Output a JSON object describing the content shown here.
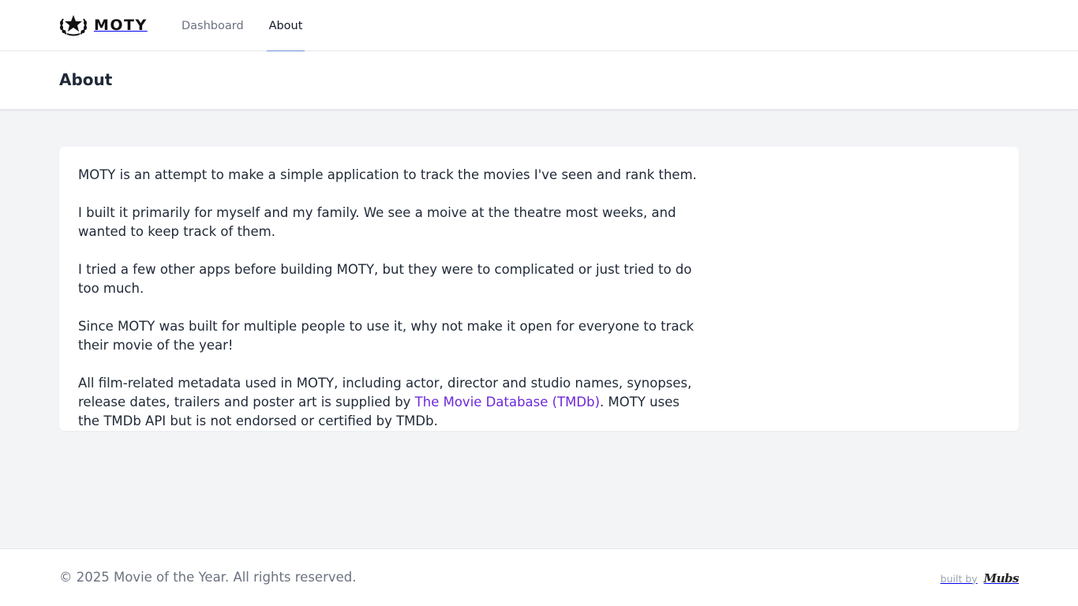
{
  "nav": {
    "logo_text": "MOTY",
    "logo_icon": "laurel-star-icon",
    "links": [
      {
        "label": "Dashboard",
        "active": false
      },
      {
        "label": "About",
        "active": true
      }
    ]
  },
  "header": {
    "title": "About"
  },
  "content": {
    "p1": "MOTY is an attempt to make a simple application to track the movies I've seen and rank them.",
    "p2": "I built it primarily for myself and my family. We see a moive at the theatre most weeks, and wanted to keep track of them.",
    "p3": "I tried a few other apps before building MOTY, but they were to complicated or just tried to do too much.",
    "p4": "Since MOTY was built for multiple people to use it, why not make it open for everyone to track their movie of the year!",
    "p5_before": "All film-related metadata used in MOTY, including actor, director and studio names, synopses, release dates, trailers and poster art is supplied by ",
    "p5_link": "The Movie Database (TMDb)",
    "p5_after": ". MOTY uses the TMDb API but is not endorsed or certified by TMDb."
  },
  "footer": {
    "copyright": "© 2025 Movie of the Year. All rights reserved.",
    "built_by_label": "built by",
    "built_by_name": "Mubs"
  },
  "colors": {
    "page_bg": "#f3f4f6",
    "link": "#6d28d9",
    "active_tab_underline": "#6b8fd6",
    "text": "#1f2937",
    "muted": "#6b7280"
  }
}
